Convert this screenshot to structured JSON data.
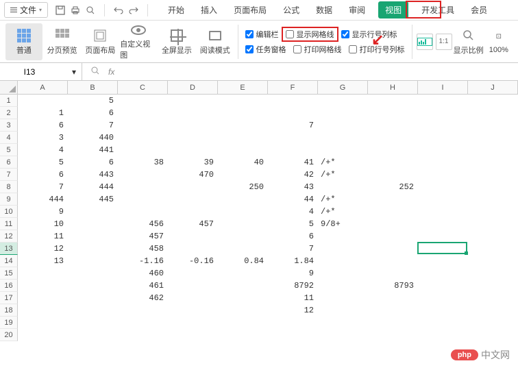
{
  "menu": {
    "file": "文件",
    "tabs": [
      "开始",
      "插入",
      "页面布局",
      "公式",
      "数据",
      "审阅",
      "视图",
      "开发工具",
      "会员"
    ],
    "active_tab_index": 6
  },
  "ribbon": {
    "buttons": [
      {
        "label": "普通",
        "active": true
      },
      {
        "label": "分页预览"
      },
      {
        "label": "页面布局"
      },
      {
        "label": "自定义视图"
      },
      {
        "label": "全屏显示"
      },
      {
        "label": "阅读模式"
      }
    ],
    "checks_row1": [
      {
        "label": "编辑栏",
        "checked": true
      },
      {
        "label": "显示网格线",
        "checked": false,
        "highlight": true
      },
      {
        "label": "显示行号列标",
        "checked": true
      }
    ],
    "checks_row2": [
      {
        "label": "任务窗格",
        "checked": true
      },
      {
        "label": "打印网格线",
        "checked": false
      },
      {
        "label": "打印行号列标",
        "checked": false
      }
    ],
    "zoom_label": "显示比例",
    "zoom_value": "100%"
  },
  "namebox": "I13",
  "columns": [
    "A",
    "B",
    "C",
    "D",
    "E",
    "F",
    "G",
    "H",
    "I",
    "J"
  ],
  "row_count": 20,
  "selected_row": 13,
  "active_cell": {
    "col": 8,
    "row": 13
  },
  "data": {
    "1": {
      "B": "5"
    },
    "2": {
      "A": "1",
      "B": "6"
    },
    "3": {
      "A": "6",
      "B": "7",
      "F": "7"
    },
    "4": {
      "A": "3",
      "B": "440"
    },
    "5": {
      "A": "4",
      "B": "441"
    },
    "6": {
      "A": "5",
      "B": "6",
      "C": "38",
      "D": "39",
      "E": "40",
      "F": "41",
      "G": "/+*"
    },
    "7": {
      "A": "6",
      "B": "443",
      "D": "470",
      "F": "42",
      "G": "/+*"
    },
    "8": {
      "A": "7",
      "B": "444",
      "E": "250",
      "F": "43",
      "H": "252"
    },
    "9": {
      "A": "444",
      "B": "445",
      "F": "44",
      "G": "/+*"
    },
    "10": {
      "A": "9",
      "F": "4",
      "G": "/+*"
    },
    "11": {
      "A": "10",
      "C": "456",
      "D": "457",
      "F": "5",
      "G": "9/8+"
    },
    "12": {
      "A": "11",
      "C": "457",
      "F": "6"
    },
    "13": {
      "A": "12",
      "C": "458",
      "F": "7"
    },
    "14": {
      "A": "13",
      "C": "-1.16",
      "D": "-0.16",
      "E": "0.84",
      "F": "1.84"
    },
    "15": {
      "C": "460",
      "F": "9"
    },
    "16": {
      "C": "461",
      "F": "8792",
      "H": "8793"
    },
    "17": {
      "C": "462",
      "F": "11"
    },
    "18": {
      "F": "12"
    }
  },
  "watermark": {
    "badge": "php",
    "text": "中文网"
  }
}
